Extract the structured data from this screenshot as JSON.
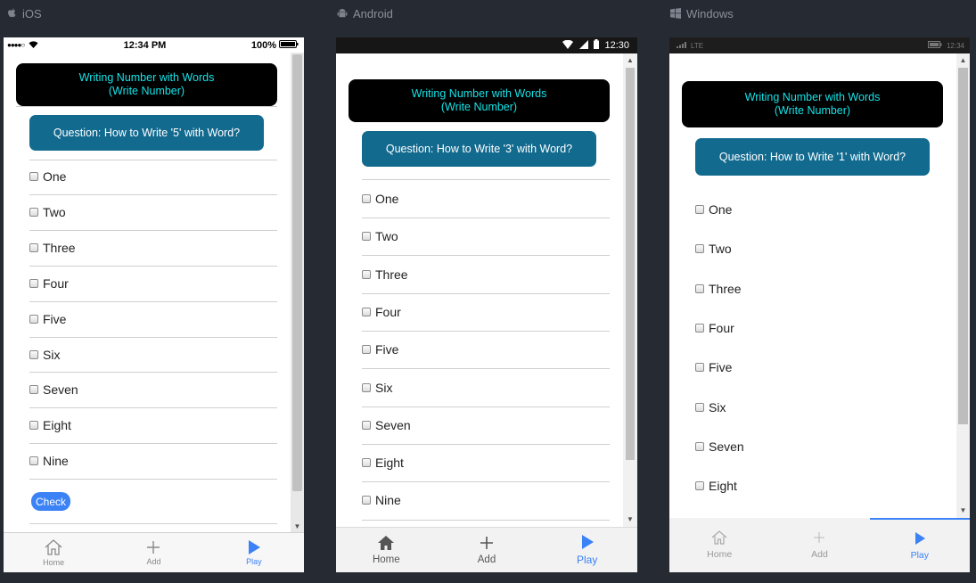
{
  "platforms": [
    {
      "name": "iOS",
      "status": {
        "carrier": "●●●●○",
        "time": "12:34 PM",
        "battery": "100%"
      },
      "header": {
        "line1": "Writing Number with Words",
        "line2": "(Write Number)"
      },
      "question": "Question: How to Write '5' with Word?",
      "options": [
        "One",
        "Two",
        "Three",
        "Four",
        "Five",
        "Six",
        "Seven",
        "Eight",
        "Nine"
      ],
      "check_label": "Check",
      "tabs": [
        {
          "label": "Home",
          "icon": "home-icon"
        },
        {
          "label": "Add",
          "icon": "plus-icon"
        },
        {
          "label": "Play",
          "icon": "play-icon"
        }
      ],
      "active_tab": "Play"
    },
    {
      "name": "Android",
      "status": {
        "time": "12:30"
      },
      "header": {
        "line1": "Writing Number with Words",
        "line2": "(Write Number)"
      },
      "question": "Question: How to Write '3' with Word?",
      "options": [
        "One",
        "Two",
        "Three",
        "Four",
        "Five",
        "Six",
        "Seven",
        "Eight",
        "Nine"
      ],
      "tabs": [
        {
          "label": "Home",
          "icon": "home-icon"
        },
        {
          "label": "Add",
          "icon": "plus-icon"
        },
        {
          "label": "Play",
          "icon": "play-icon"
        }
      ],
      "active_tab": "Play"
    },
    {
      "name": "Windows",
      "status": {
        "signal": "LTE",
        "time": "12:34"
      },
      "header": {
        "line1": "Writing Number with Words",
        "line2": "(Write Number)"
      },
      "question": "Question: How to Write '1' with Word?",
      "options": [
        "One",
        "Two",
        "Three",
        "Four",
        "Five",
        "Six",
        "Seven",
        "Eight"
      ],
      "tabs": [
        {
          "label": "Home",
          "icon": "home-icon"
        },
        {
          "label": "Add",
          "icon": "plus-icon"
        },
        {
          "label": "Play",
          "icon": "play-icon"
        }
      ],
      "active_tab": "Play"
    }
  ],
  "colors": {
    "header_text": "#16e3e8",
    "question_bg": "#126a8f",
    "accent": "#3b82f6",
    "page_bg": "#262b33"
  }
}
